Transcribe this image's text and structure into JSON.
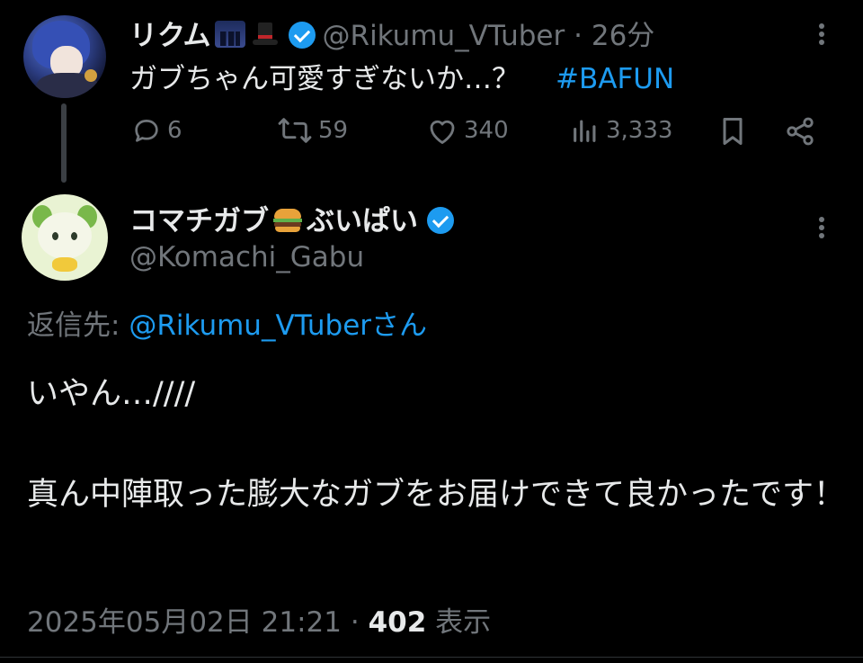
{
  "parent_tweet": {
    "display_name": "リクム",
    "handle": "@Rikumu_VTuber",
    "separator": "·",
    "time": "26分",
    "text": "ガブちゃん可愛すぎないか…？",
    "hashtag": "#BAFUN",
    "name_emojis": [
      "night-city-emoji",
      "top-hat-emoji"
    ],
    "actions": {
      "replies": "6",
      "reposts": "59",
      "likes": "340",
      "views": "3,333"
    }
  },
  "main_tweet": {
    "display_name_prefix": "コマチガブ",
    "display_name_suffix": "ぶいぱい",
    "name_emoji": "hamburger-emoji",
    "handle": "@Komachi_Gabu",
    "reply_to_label": "返信先:",
    "reply_to_user": "@Rikumu_VTuberさん",
    "text_line1": "いやん…////",
    "text_line2": "真ん中陣取った膨大なガブをお届けできて良かったです！",
    "date": "2025年05月02日 21:21",
    "separator": "·",
    "views_count": "402",
    "views_label": "表示"
  },
  "colors": {
    "background": "#000000",
    "text": "#e7e9ea",
    "muted": "#71767b",
    "accent": "#1d9bf0"
  },
  "icons": [
    "more-icon",
    "reply-icon",
    "repost-icon",
    "like-icon",
    "views-icon",
    "bookmark-icon",
    "share-icon",
    "verified-badge-icon"
  ]
}
